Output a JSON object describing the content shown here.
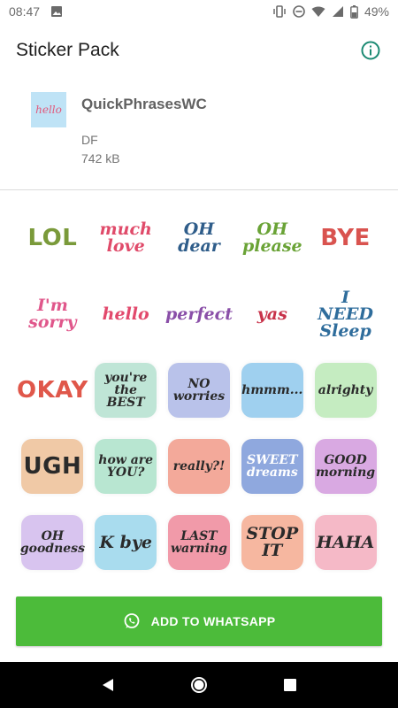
{
  "status_bar": {
    "time": "08:47",
    "battery": "49%"
  },
  "app_bar": {
    "title": "Sticker Pack"
  },
  "pack": {
    "tray_text": "hello",
    "name": "QuickPhrasesWC",
    "publisher": "DF",
    "size": "742 kB"
  },
  "stickers": [
    {
      "text": "LOL",
      "style": "big",
      "color": "#7a9a3a",
      "bg": ""
    },
    {
      "text": "much love",
      "style": "mid",
      "color": "#e04b6a",
      "bg": ""
    },
    {
      "text": "OH dear",
      "style": "mid",
      "color": "#2f5d8a",
      "bg": ""
    },
    {
      "text": "OH please",
      "style": "mid",
      "color": "#6aa336",
      "bg": ""
    },
    {
      "text": "BYE",
      "style": "big",
      "color": "#d9534f",
      "bg": ""
    },
    {
      "text": "I'm sorry",
      "style": "mid",
      "color": "#e0578b",
      "bg": ""
    },
    {
      "text": "hello",
      "style": "mid",
      "color": "#e2496c",
      "bg": ""
    },
    {
      "text": "perfect",
      "style": "mid",
      "color": "#8a4fa8",
      "bg": ""
    },
    {
      "text": "yas",
      "style": "mid",
      "color": "#c8324a",
      "bg": ""
    },
    {
      "text": "I NEED Sleep",
      "style": "mid",
      "color": "#2f6d9c",
      "bg": ""
    },
    {
      "text": "OKAY",
      "style": "big",
      "color": "#e0574a",
      "bg": ""
    },
    {
      "text": "you're the BEST",
      "style": "sm",
      "color": "#2a2a2a",
      "bg": "#bfe5d6"
    },
    {
      "text": "NO worries",
      "style": "sm",
      "color": "#2a2a2a",
      "bg": "#b9c2ea"
    },
    {
      "text": "hmmm...",
      "style": "sm",
      "color": "#2a2a2a",
      "bg": "#9fd0ef"
    },
    {
      "text": "alrighty",
      "style": "sm",
      "color": "#2a2a2a",
      "bg": "#c5ecc1"
    },
    {
      "text": "UGH",
      "style": "big",
      "color": "#2a2a2a",
      "bg": "#f0c9a6"
    },
    {
      "text": "how are YOU?",
      "style": "sm",
      "color": "#2a2a2a",
      "bg": "#b8e6d1"
    },
    {
      "text": "really?!",
      "style": "sm",
      "color": "#2a2a2a",
      "bg": "#f3a99a"
    },
    {
      "text": "SWEET dreams",
      "style": "sm",
      "color": "#ffffff",
      "bg": "#8fa8de"
    },
    {
      "text": "GOOD morning",
      "style": "sm",
      "color": "#2a2a2a",
      "bg": "#d9a9e2"
    },
    {
      "text": "OH goodness",
      "style": "sm",
      "color": "#2a2a2a",
      "bg": "#d8c4ef"
    },
    {
      "text": "K bye",
      "style": "mid",
      "color": "#2a2a2a",
      "bg": "#a9dcee"
    },
    {
      "text": "LAST warning",
      "style": "sm",
      "color": "#2a2a2a",
      "bg": "#f19aa9"
    },
    {
      "text": "STOP IT",
      "style": "mid",
      "color": "#2a2a2a",
      "bg": "#f6b7a0"
    },
    {
      "text": "HAHA",
      "style": "mid",
      "color": "#2a2a2a",
      "bg": "#f5b9c7"
    }
  ],
  "add_button": {
    "icon": "whatsapp-icon",
    "label": "ADD TO WHATSAPP",
    "color": "#4cbb3a"
  },
  "nav": {
    "back_icon": "back-triangle-icon",
    "home_icon": "home-circle-icon",
    "recents_icon": "recents-square-icon"
  }
}
